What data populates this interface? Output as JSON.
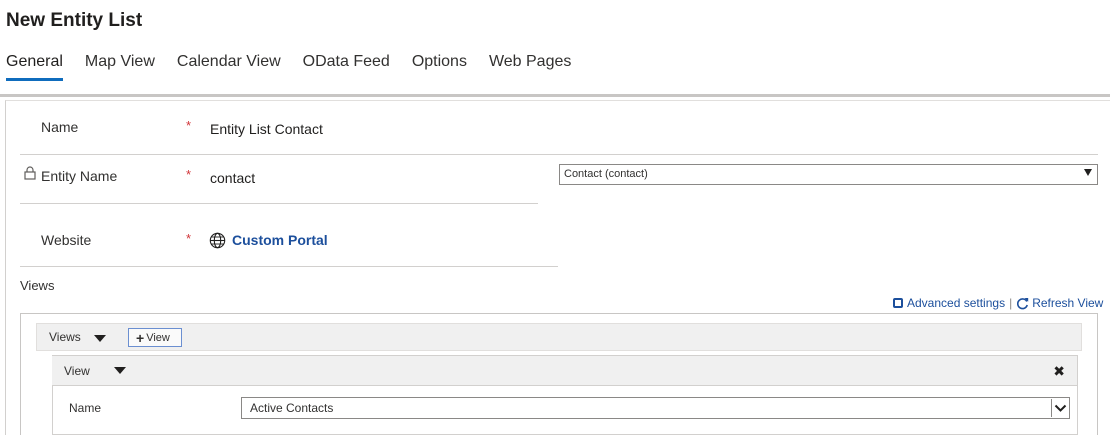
{
  "page": {
    "title": "New Entity List"
  },
  "tabs": [
    {
      "label": "General",
      "active": true
    },
    {
      "label": "Map View"
    },
    {
      "label": "Calendar View"
    },
    {
      "label": "OData Feed"
    },
    {
      "label": "Options"
    },
    {
      "label": "Web Pages"
    }
  ],
  "form": {
    "name": {
      "label": "Name",
      "required": "*",
      "value": "Entity List Contact"
    },
    "entity_name": {
      "label": "Entity Name",
      "required": "*",
      "value": "contact",
      "select_value": "Contact (contact)",
      "locked_icon": "lock-icon"
    },
    "website": {
      "label": "Website",
      "required": "*",
      "value": "Custom Portal",
      "icon": "globe-icon"
    }
  },
  "views_section": {
    "caption": "Views",
    "advanced_settings": "Advanced settings",
    "separator": "|",
    "refresh_view": "Refresh View",
    "views_bar_label": "Views",
    "add_view_label": "View",
    "view_card": {
      "label": "View",
      "close_glyph": "✖",
      "name_label": "Name",
      "name_value": "Active Contacts"
    }
  },
  "colors": {
    "accent": "#0f6cbd",
    "link": "#1c4f9c",
    "required": "#d13438"
  }
}
